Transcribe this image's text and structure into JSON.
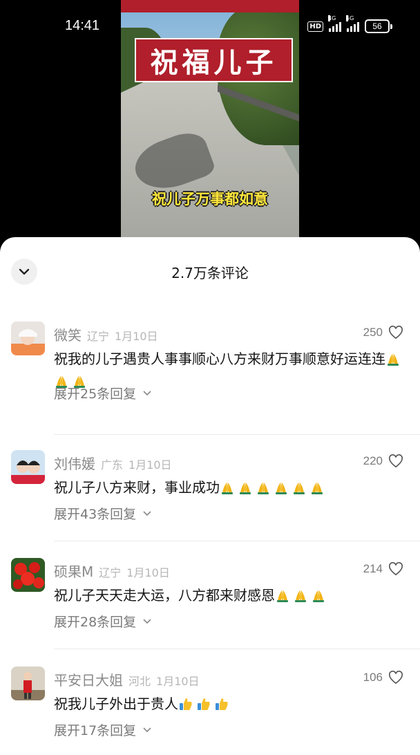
{
  "status_bar": {
    "time": "14:41",
    "network_4g": "4G",
    "network_5g": "5G",
    "hd_label": "HD",
    "battery": "56"
  },
  "video": {
    "title_text": "祝福儿子",
    "subtitle": "祝儿子万事都如意"
  },
  "comments_sheet": {
    "title": "2.7万条评论",
    "comments": [
      {
        "author": "微笑",
        "region": "辽宁",
        "date": "1月10日",
        "likes": "250",
        "text": "祝我的儿子遇贵人事事顺心八方来财万事顺意好运连连",
        "emoji": "pray",
        "emoji_count": 3,
        "replies": "展开25条回复"
      },
      {
        "author": "刘伟媛",
        "region": "广东",
        "date": "1月10日",
        "likes": "220",
        "text": "祝儿子八方来财，事业成功",
        "emoji": "pray",
        "emoji_count": 6,
        "replies": "展开43条回复"
      },
      {
        "author": "硕果M",
        "region": "辽宁",
        "date": "1月10日",
        "likes": "214",
        "text": "祝儿子天天走大运，八方都来财感恩",
        "emoji": "pray",
        "emoji_count": 3,
        "replies": "展开28条回复"
      },
      {
        "author": "平安日大姐",
        "region": "河北",
        "date": "1月10日",
        "likes": "106",
        "text": "祝我儿子外出于贵人",
        "emoji": "thumbs-up",
        "emoji_count": 3,
        "replies": "展开17条回复"
      }
    ]
  },
  "colors": {
    "banner_red": "#b01f2b",
    "subtitle_yellow": "#ffe73a",
    "meta_gray": "#8a8a8a"
  }
}
